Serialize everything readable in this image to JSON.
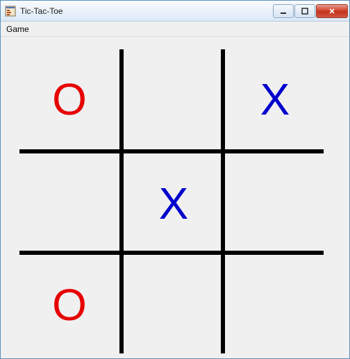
{
  "window": {
    "title": "Tic-Tac-Toe"
  },
  "menubar": {
    "game": "Game"
  },
  "players": {
    "X": {
      "symbol": "X",
      "color": "#0000cc"
    },
    "O": {
      "symbol": "O",
      "color": "#e60000"
    }
  },
  "board": {
    "cells": [
      [
        "O",
        "",
        "X"
      ],
      [
        "",
        "X",
        ""
      ],
      [
        "O",
        "",
        ""
      ]
    ]
  }
}
